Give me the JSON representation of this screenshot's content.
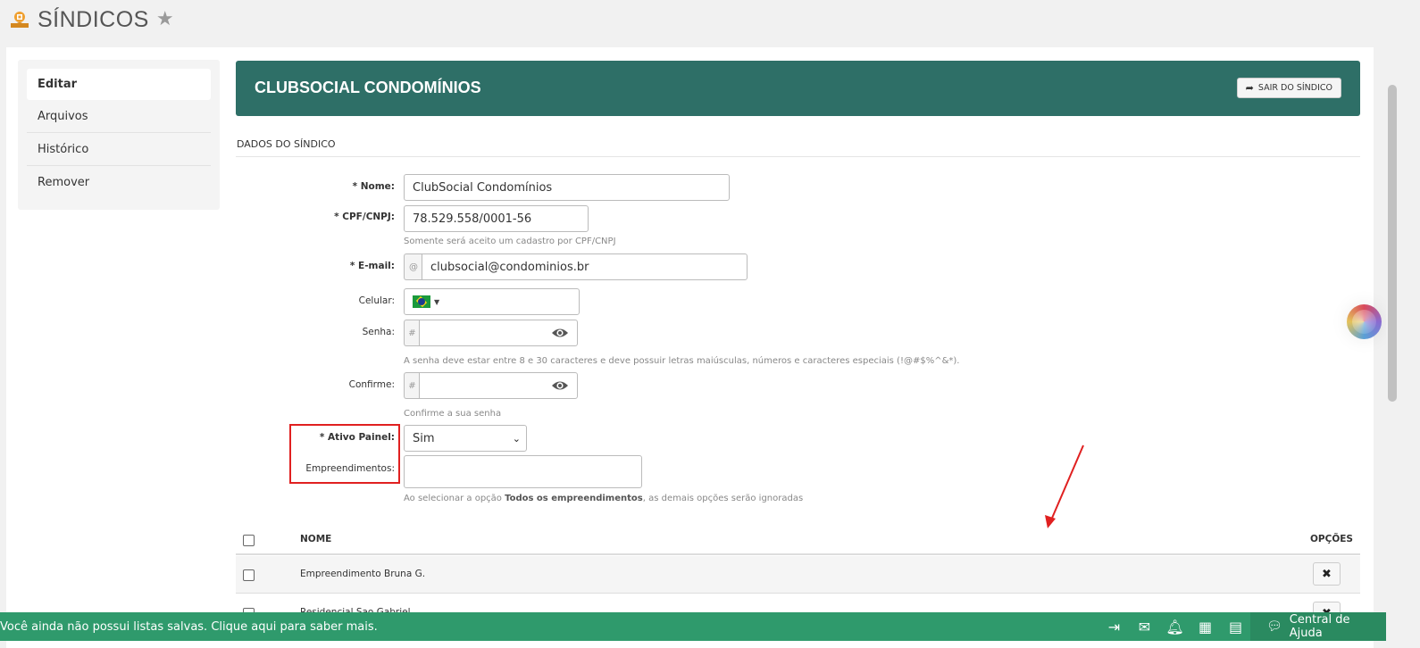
{
  "header": {
    "title": "SÍNDICOS"
  },
  "sidebar": {
    "items": [
      {
        "label": "Editar",
        "active": true
      },
      {
        "label": "Arquivos"
      },
      {
        "label": "Histórico"
      },
      {
        "label": "Remover"
      }
    ]
  },
  "main": {
    "title": "CLUBSOCIAL CONDOMÍNIOS",
    "exit_label": "SAIR DO SÍNDICO",
    "section": "DADOS DO SÍNDICO"
  },
  "form": {
    "nome": {
      "label": "Nome:",
      "value": "ClubSocial Condomínios"
    },
    "cpf": {
      "label": "CPF/CNPJ:",
      "value": "78.529.558/0001-56",
      "help": "Somente será aceito um cadastro por CPF/CNPJ"
    },
    "email": {
      "label": "E-mail:",
      "addon": "@",
      "value": "clubsocial@condominios.br"
    },
    "celular": {
      "label": "Celular:",
      "value": ""
    },
    "senha": {
      "label": "Senha:",
      "addon": "#",
      "value": "",
      "help": "A senha deve estar entre 8 e 30 caracteres e deve possuir letras maiúsculas, números e caracteres especiais (!@#$%^&*)."
    },
    "confirme": {
      "label": "Confirme:",
      "addon": "#",
      "value": "",
      "help": "Confirme a sua senha"
    },
    "ativo": {
      "label": "Ativo Painel:",
      "selected": "Sim"
    },
    "empreendimentos": {
      "label": "Empreendimentos:",
      "help_pre": "Ao selecionar a opção ",
      "help_bold": "Todos os empreendimentos",
      "help_post": ", as demais opções serão ignoradas"
    },
    "required_mark": "*"
  },
  "table": {
    "col_name": "NOME",
    "col_options": "OPÇÕES",
    "rows": [
      {
        "name": "Empreendimento Bruna G."
      },
      {
        "name": "Residencial Sao Gabriel"
      }
    ]
  },
  "bottom_bar": {
    "message": "Você ainda não possui listas salvas. Clique aqui para saber mais.",
    "help_center": "Central de Ajuda"
  },
  "colors": {
    "title_bar": "#2e6f67",
    "bottom_bar": "#2f9a6c",
    "highlight": "#e02020"
  }
}
